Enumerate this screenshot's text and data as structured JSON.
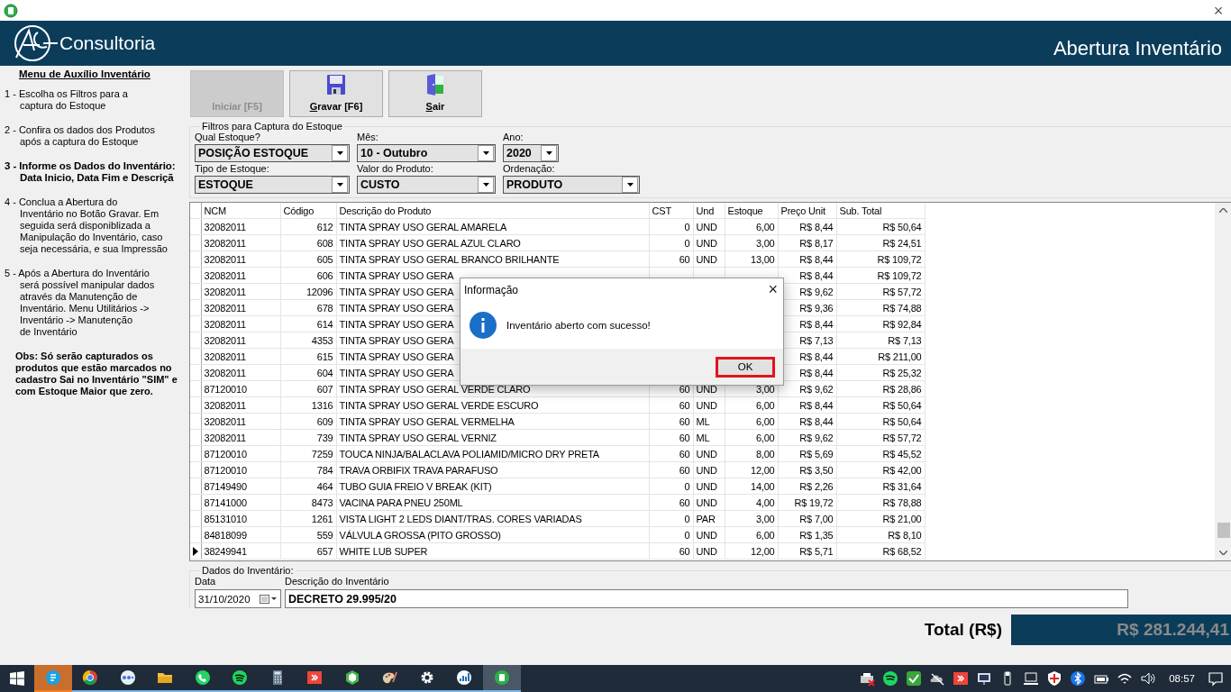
{
  "window": {
    "close": "×"
  },
  "header": {
    "brand": "Consultoria",
    "title": "Abertura Inventário"
  },
  "sidebar": {
    "title": "Menu de Auxílio Inventário",
    "steps": [
      {
        "kind": "normal",
        "text": "1 - Escolha os Filtros para a\ncaptura do Estoque"
      },
      {
        "kind": "normal",
        "text": "2 - Confira os dados dos Produtos\napós a captura do Estoque"
      },
      {
        "kind": "bold",
        "text": "3 - Informe os Dados do Inventário:\nData Inicio, Data Fim e Descriçã"
      },
      {
        "kind": "normal",
        "text": "4 - Conclua a Abertura do\nInventário no Botão Gravar. Em\nseguida será disponiblizada a\nManipulação do Inventário, caso\nseja necessária, e sua Impressão"
      },
      {
        "kind": "normal",
        "text": "5 - Após a Abertura do Inventário\nserá possível manipular dados\natravés da Manutenção de\nInventário. Menu Utilitários ->\nInventário -> Manutenção\nde Inventário"
      }
    ],
    "note": "Obs: Só serão capturados os produtos que estão marcados no cadastro Sai no Inventário \"SIM\" e com Estoque Maior que zero."
  },
  "toolbar": [
    {
      "kind": "start",
      "label": "Iniciar [F5]",
      "disabled": true
    },
    {
      "kind": "save",
      "label": "Gravar [F6]",
      "disabled": false
    },
    {
      "kind": "exit",
      "label": "Sair",
      "disabled": false
    }
  ],
  "filters": {
    "legend": "Filtros para Captura do Estoque",
    "fields": [
      {
        "label": "Qual Estoque?",
        "value": "POSIÇÃO ESTOQUE"
      },
      {
        "label": "Mês:",
        "value": "10 - Outubro"
      },
      {
        "label": "Ano:",
        "value": "2020"
      },
      {
        "label": "Tipo de Estoque:",
        "value": "ESTOQUE"
      },
      {
        "label": "Valor do Produto:",
        "value": "CUSTO"
      },
      {
        "label": "Ordenação:",
        "value": "PRODUTO"
      }
    ]
  },
  "table": {
    "columns": [
      "NCM",
      "Código",
      "Descrição do Produto",
      "CST",
      "Und",
      "Estoque",
      "Preço Unit",
      "Sub. Total"
    ],
    "rows": [
      {
        "current": false,
        "cells": [
          "32082011",
          "612",
          "TINTA SPRAY USO GERAL AMARELA",
          "0",
          "UND",
          "6,00",
          "R$ 8,44",
          "R$ 50,64"
        ]
      },
      {
        "current": false,
        "cells": [
          "32082011",
          "608",
          "TINTA SPRAY USO GERAL AZUL CLARO",
          "0",
          "UND",
          "3,00",
          "R$ 8,17",
          "R$ 24,51"
        ]
      },
      {
        "current": false,
        "cells": [
          "32082011",
          "605",
          "TINTA SPRAY USO GERAL BRANCO BRILHANTE",
          "60",
          "UND",
          "13,00",
          "R$ 8,44",
          "R$ 109,72"
        ]
      },
      {
        "current": false,
        "cells": [
          "32082011",
          "606",
          "TINTA SPRAY USO GERA",
          "",
          "",
          "",
          "R$ 8,44",
          "R$ 109,72"
        ]
      },
      {
        "current": false,
        "cells": [
          "32082011",
          "12096",
          "TINTA SPRAY USO GERA",
          "",
          "",
          "",
          "R$ 9,62",
          "R$ 57,72"
        ]
      },
      {
        "current": false,
        "cells": [
          "32082011",
          "678",
          "TINTA SPRAY USO GERA",
          "",
          "",
          "",
          "R$ 9,36",
          "R$ 74,88"
        ]
      },
      {
        "current": false,
        "cells": [
          "32082011",
          "614",
          "TINTA SPRAY USO GERA",
          "",
          "",
          "",
          "R$ 8,44",
          "R$ 92,84"
        ]
      },
      {
        "current": false,
        "cells": [
          "32082011",
          "4353",
          "TINTA SPRAY USO GERA",
          "",
          "",
          "",
          "R$ 7,13",
          "R$ 7,13"
        ]
      },
      {
        "current": false,
        "cells": [
          "32082011",
          "615",
          "TINTA SPRAY USO GERA",
          "",
          "",
          "",
          "R$ 8,44",
          "R$ 211,00"
        ]
      },
      {
        "current": false,
        "cells": [
          "32082011",
          "604",
          "TINTA SPRAY USO GERA",
          "",
          "",
          "",
          "R$ 8,44",
          "R$ 25,32"
        ]
      },
      {
        "current": false,
        "cells": [
          "87120010",
          "607",
          "TINTA SPRAY USO GERAL VERDE CLARO",
          "60",
          "UND",
          "3,00",
          "R$ 9,62",
          "R$ 28,86"
        ]
      },
      {
        "current": false,
        "cells": [
          "32082011",
          "1316",
          "TINTA SPRAY USO GERAL VERDE ESCURO",
          "60",
          "UND",
          "6,00",
          "R$ 8,44",
          "R$ 50,64"
        ]
      },
      {
        "current": false,
        "cells": [
          "32082011",
          "609",
          "TINTA SPRAY USO GERAL VERMELHA",
          "60",
          "ML",
          "6,00",
          "R$ 8,44",
          "R$ 50,64"
        ]
      },
      {
        "current": false,
        "cells": [
          "32082011",
          "739",
          "TINTA SPRAY USO GERAL VERNIZ",
          "60",
          "ML",
          "6,00",
          "R$ 9,62",
          "R$ 57,72"
        ]
      },
      {
        "current": false,
        "cells": [
          "87120010",
          "7259",
          "TOUCA NINJA/BALACLAVA POLIAMID/MICRO DRY PRETA",
          "60",
          "UND",
          "8,00",
          "R$ 5,69",
          "R$ 45,52"
        ]
      },
      {
        "current": false,
        "cells": [
          "87120010",
          "784",
          "TRAVA ORBIFIX TRAVA PARAFUSO",
          "60",
          "UND",
          "12,00",
          "R$ 3,50",
          "R$ 42,00"
        ]
      },
      {
        "current": false,
        "cells": [
          "87149490",
          "464",
          "TUBO GUIA FREIO V BREAK (KIT)",
          "0",
          "UND",
          "14,00",
          "R$ 2,26",
          "R$ 31,64"
        ]
      },
      {
        "current": false,
        "cells": [
          "87141000",
          "8473",
          "VACINA PARA PNEU 250ML",
          "60",
          "UND",
          "4,00",
          "R$ 19,72",
          "R$ 78,88"
        ]
      },
      {
        "current": false,
        "cells": [
          "85131010",
          "1261",
          "VISTA LIGHT 2 LEDS DIANT/TRAS. CORES VARIADAS",
          "0",
          "PAR",
          "3,00",
          "R$ 7,00",
          "R$ 21,00"
        ]
      },
      {
        "current": false,
        "cells": [
          "84818099",
          "559",
          "VÁLVULA GROSSA (PITO GROSSO)",
          "0",
          "UND",
          "6,00",
          "R$ 1,35",
          "R$ 8,10"
        ]
      },
      {
        "current": true,
        "cells": [
          "38249941",
          "657",
          "WHITE LUB SUPER",
          "60",
          "UND",
          "12,00",
          "R$ 5,71",
          "R$ 68,52"
        ]
      }
    ]
  },
  "inventory": {
    "legend": "Dados do Inventário:",
    "date_label": "Data",
    "date": "31/10/2020",
    "description_label": "Descrição do Inventário",
    "description": "DECRETO 29.995/20",
    "total_label": "Total (R$)",
    "total": "R$ 281.244,41"
  },
  "dialog": {
    "title": "Informação",
    "close": "×",
    "message": "Inventário aberto com sucesso!",
    "button": {
      "label": "OK",
      "highlighted": true
    }
  },
  "taskbar": {
    "apps": [
      {
        "kind": "chat",
        "running": true,
        "flashing": true,
        "selected": false
      },
      {
        "kind": "browser",
        "running": true,
        "flashing": false,
        "selected": false
      },
      {
        "kind": "dots",
        "running": true,
        "flashing": false,
        "selected": false
      },
      {
        "kind": "folder",
        "running": true,
        "flashing": false,
        "selected": false
      },
      {
        "kind": "phone",
        "running": true,
        "flashing": false,
        "selected": false
      },
      {
        "kind": "music",
        "running": true,
        "flashing": false,
        "selected": false
      },
      {
        "kind": "calculator",
        "running": true,
        "flashing": false,
        "selected": false
      },
      {
        "kind": "remote",
        "running": true,
        "flashing": false,
        "selected": false
      },
      {
        "kind": "hexagon",
        "running": true,
        "flashing": false,
        "selected": false
      },
      {
        "kind": "palette",
        "running": true,
        "flashing": false,
        "selected": false
      },
      {
        "kind": "gear",
        "running": true,
        "flashing": false,
        "selected": false
      },
      {
        "kind": "chart",
        "running": true,
        "flashing": false,
        "selected": false
      },
      {
        "kind": "app",
        "running": true,
        "flashing": false,
        "selected": true
      }
    ],
    "clock": "08:57"
  }
}
